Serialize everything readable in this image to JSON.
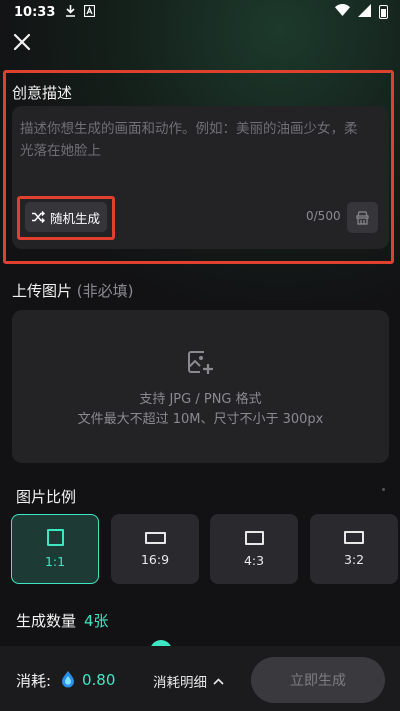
{
  "status_bar": {
    "time": "10:33"
  },
  "creative": {
    "title": "创意描述",
    "placeholder": "描述你想生成的画面和动作。例如：美丽的油画少女，柔光落在她脸上",
    "random_label": "随机生成",
    "char_count": "0/500"
  },
  "upload": {
    "title": "上传图片",
    "optional": "(非必填)",
    "line1": "支持 JPG / PNG 格式",
    "line2": "文件最大不超过 10M、尺寸不小于 300px"
  },
  "ratio": {
    "title": "图片比例",
    "options": [
      {
        "label": "1:1",
        "selected": true
      },
      {
        "label": "16:9",
        "selected": false
      },
      {
        "label": "4:3",
        "selected": false
      },
      {
        "label": "3:2",
        "selected": false
      }
    ]
  },
  "quantity": {
    "title": "生成数量",
    "value": "4张"
  },
  "footer": {
    "cost_label": "消耗:",
    "cost_value": "0.80",
    "detail_label": "消耗明细",
    "generate_label": "立即生成"
  },
  "colors": {
    "accent": "#3ee6c2",
    "highlight": "#e0402e",
    "background": "#121214"
  },
  "icons": [
    "download-icon",
    "a-icon",
    "wifi-icon",
    "signal-icon",
    "battery-icon",
    "close-icon",
    "shuffle-icon",
    "clear-icon",
    "image-add-icon",
    "coin-icon",
    "chevron-up-icon"
  ]
}
